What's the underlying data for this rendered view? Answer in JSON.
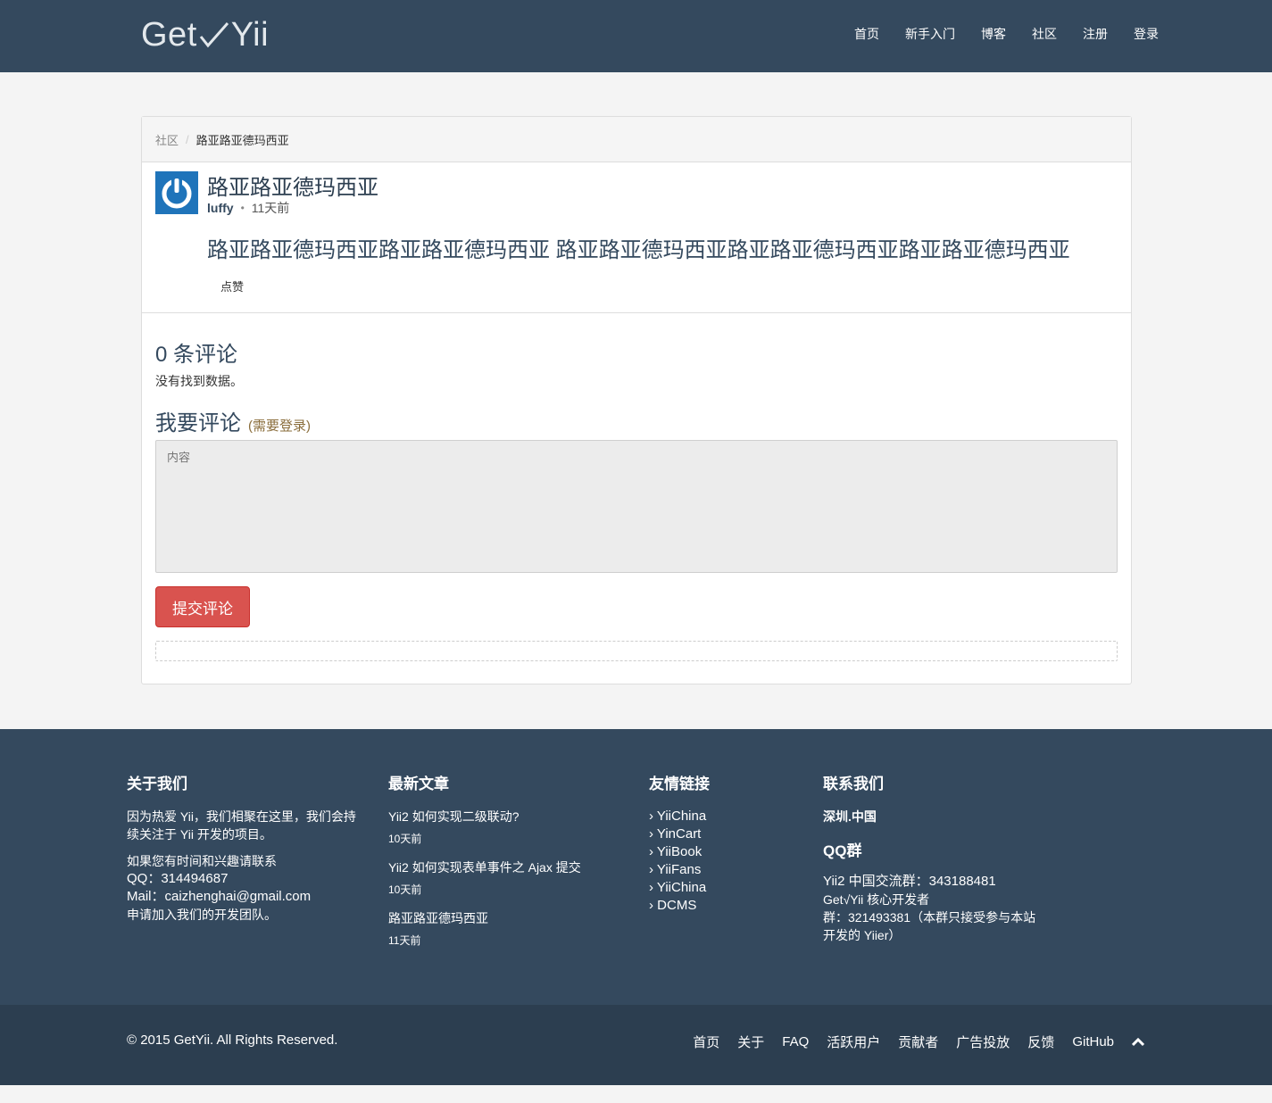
{
  "brand": {
    "left": "Get",
    "right": "Yii"
  },
  "nav": [
    "首页",
    "新手入门",
    "博客",
    "社区",
    "注册",
    "登录"
  ],
  "breadcrumb": {
    "link": "社区",
    "sep": "/",
    "active": "路亚路亚德玛西亚"
  },
  "post": {
    "title": "路亚路亚德玛西亚",
    "author": "luffy",
    "dot": "•",
    "time": "11天前",
    "body": "路亚路亚德玛西亚路亚路亚德玛西亚 路亚路亚德玛西亚路亚路亚德玛西亚路亚路亚德玛西亚",
    "like": "点赞"
  },
  "comments": {
    "count_text": "0 条评论",
    "empty_text": "没有找到数据。",
    "write_title": "我要评论",
    "login_hint": "(需要登录)",
    "textarea_placeholder": "内容",
    "submit_label": "提交评论"
  },
  "footer": {
    "about": {
      "title": "关于我们",
      "p1": "因为热爱 Yii，我们相聚在这里，我们会持续关注于 Yii 开发的项目。",
      "p2_line1": "如果您有时间和兴趣请联系",
      "p2_line2": "QQ：314494687",
      "p2_line3": "Mail：caizhenghai@gmail.com",
      "p2_line4": "申请加入我们的开发团队。"
    },
    "latest": {
      "title": "最新文章",
      "items": [
        {
          "title": "Yii2 如何实现二级联动?",
          "time": "10天前"
        },
        {
          "title": "Yii2 如何实现表单事件之 Ajax 提交",
          "time": "10天前"
        },
        {
          "title": "路亚路亚德玛西亚",
          "time": "11天前"
        }
      ]
    },
    "links": {
      "title": "友情链接",
      "items": [
        "› YiiChina",
        "› YinCart",
        "› YiiBook",
        "› YiiFans",
        "› YiiChina",
        "› DCMS"
      ]
    },
    "contact": {
      "title": "联系我们",
      "city": "深圳.中国",
      "qq_title": "QQ群",
      "line1": "Yii2 中国交流群：343188481",
      "line2": "Get√Yii 核心开发者",
      "line3": "群：321493381（本群只接受参与本站",
      "line4": "开发的 Yiier）"
    }
  },
  "bottom": {
    "copyright": "© 2015 GetYii. All Rights Reserved.",
    "nav": [
      "首页",
      "关于",
      "FAQ",
      "活跃用户",
      "贡献者",
      "广告投放",
      "反馈",
      "GitHub"
    ]
  },
  "colors": {
    "navbar": "#34495e",
    "footer": "#34495e",
    "bottom_bar": "#2c3e50",
    "submit": "#d9534f",
    "avatar": "#1f74ba",
    "hint": "#8a6d3b"
  },
  "icons": {
    "to_top": "chevron-up-icon",
    "avatar": "power-icon",
    "brand_check": "checkmark-icon"
  }
}
